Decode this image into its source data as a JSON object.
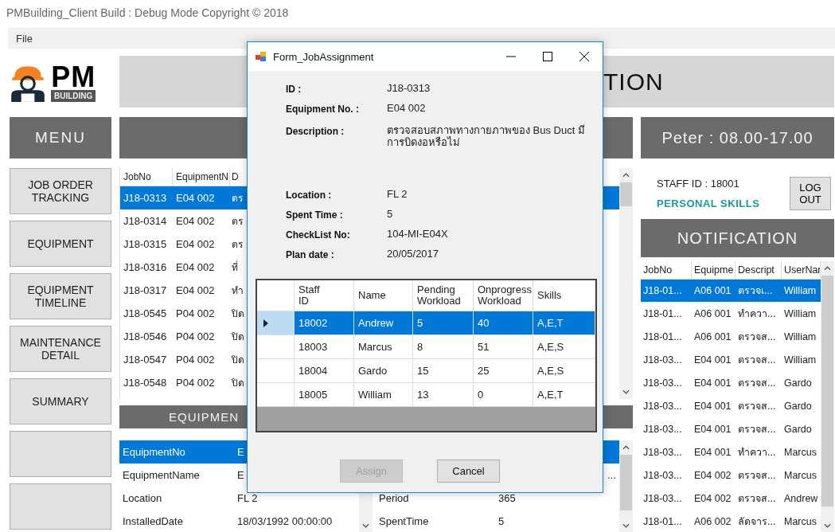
{
  "app_title": "PMBuilding_Client Build : Debug Mode  Copyright ©  2018",
  "menu_bar": [
    {
      "label": "File"
    }
  ],
  "logo": {
    "main": "PM",
    "sub": "BUILDING"
  },
  "header": {
    "title": "TION"
  },
  "menu": {
    "title": "MENU",
    "items": [
      {
        "kind": "button",
        "label": "JOB ORDER TRACKING"
      },
      {
        "kind": "button",
        "label": "EQUIPMENT"
      },
      {
        "kind": "button",
        "label": "EQUIPMENT TIMELINE"
      },
      {
        "kind": "button",
        "label": "MAINTENANCE DETAIL"
      },
      {
        "kind": "button",
        "label": "SUMMARY"
      },
      {
        "kind": "blank"
      },
      {
        "kind": "blank"
      }
    ]
  },
  "jobs": {
    "columns": [
      "JobNo",
      "EquipmentN",
      "D"
    ],
    "rows": [
      {
        "cells": [
          "J18-0313",
          "E04 002",
          "ตร"
        ],
        "selected": true
      },
      {
        "cells": [
          "J18-0314",
          "E04 002",
          "ตร"
        ],
        "selected": false
      },
      {
        "cells": [
          "J18-0315",
          "E04 002",
          "ตร"
        ],
        "selected": false
      },
      {
        "cells": [
          "J18-0316",
          "E04 002",
          "ที่"
        ],
        "selected": false
      },
      {
        "cells": [
          "J18-0317",
          "E04 002",
          "ทำ"
        ],
        "selected": false
      },
      {
        "cells": [
          "J18-0545",
          "P04 002",
          "ปิด"
        ],
        "selected": false
      },
      {
        "cells": [
          "J18-0546",
          "P04 002",
          "ปิด"
        ],
        "selected": false
      },
      {
        "cells": [
          "J18-0547",
          "P04 002",
          "ปิด"
        ],
        "selected": false
      },
      {
        "cells": [
          "J18-0548",
          "P04 002",
          "ปิด"
        ],
        "selected": false
      }
    ]
  },
  "equipment": {
    "title": "EQUIPMEN",
    "left": [
      {
        "name": "EquipmentNo",
        "value": "E",
        "selected": true
      },
      {
        "name": "EquipmentName",
        "value": "E",
        "selected": false
      },
      {
        "name": "Location",
        "value": "FL 2",
        "selected": false
      },
      {
        "name": "InstalledDate",
        "value": "18/03/1992 00:00:00",
        "selected": false
      }
    ],
    "right": [
      {
        "selected": true
      },
      {
        "value": "...",
        "selected": false
      },
      {
        "name": "Period",
        "value": "365",
        "selected": false
      },
      {
        "name": "SpentTime",
        "value": "5",
        "selected": false
      }
    ]
  },
  "user": {
    "title": "Peter : 08.00-17.00",
    "staff_id": "STAFF ID : 18001",
    "skills_link": "PERSONAL SKILLS",
    "logout": "LOG OUT"
  },
  "notification": {
    "title": "NOTIFICATION",
    "columns": [
      "JobNo",
      "Equipme",
      "Descript",
      "UserNar"
    ],
    "rows": [
      {
        "cells": [
          "J18-01...",
          "A06 001",
          "ตรวจเ...",
          "William"
        ],
        "selected": true
      },
      {
        "cells": [
          "J18-01...",
          "A06 001",
          "ทำควา...",
          "William"
        ],
        "selected": false
      },
      {
        "cells": [
          "J18-01...",
          "A06 001",
          "ตรวจส...",
          "William"
        ],
        "selected": false
      },
      {
        "cells": [
          "J18-03...",
          "E04 001",
          "ตรวจส...",
          "William"
        ],
        "selected": false
      },
      {
        "cells": [
          "J18-03...",
          "E04 001",
          "ตรวจส...",
          "Gardo"
        ],
        "selected": false
      },
      {
        "cells": [
          "J18-03...",
          "E04 001",
          "ตรวจส...",
          "Gardo"
        ],
        "selected": false
      },
      {
        "cells": [
          "J18-03...",
          "E04 001",
          "ตรวจส...",
          "Gardo"
        ],
        "selected": false
      },
      {
        "cells": [
          "J18-03...",
          "E04 001",
          "ทำควา...",
          "Marcus"
        ],
        "selected": false
      },
      {
        "cells": [
          "J18-03...",
          "E04 002",
          "ตรวจส...",
          "Marcus"
        ],
        "selected": false
      },
      {
        "cells": [
          "J18-03...",
          "E04 002",
          "ตรวจส...",
          "Andrew"
        ],
        "selected": false
      },
      {
        "cells": [
          "J18-01...",
          "A06 002",
          "ลัดจาร...",
          "Marcus"
        ],
        "selected": false
      }
    ]
  },
  "dialog": {
    "title": "Form_JobAssignment",
    "fields": [
      {
        "kind": "line",
        "label": "ID :",
        "value": "J18-0313"
      },
      {
        "kind": "line",
        "label": "Equipment No. :",
        "value": "E04 002"
      },
      {
        "kind": "multiline",
        "label": "Description :",
        "value": "ตรวจสอบสภาพทางกายภาพของ Bus Duct มีการบิดงอหรือไม่"
      },
      {
        "kind": "line",
        "label": "Location :",
        "value": "FL 2"
      },
      {
        "kind": "line",
        "label": "Spent Time :",
        "value": "5"
      },
      {
        "kind": "line",
        "label": "CheckList No:",
        "value": "104-MI-E04X"
      },
      {
        "kind": "line",
        "label": "Plan date :",
        "value": "20/05/2017"
      }
    ],
    "staff_grid": {
      "columns": [
        "Staff ID",
        "Name",
        "Pending Workload",
        "Onprogress Workload",
        "Skills"
      ],
      "rows": [
        {
          "cells": [
            "18002",
            "Andrew",
            "5",
            "40",
            "A,E,T"
          ],
          "selected": true
        },
        {
          "cells": [
            "18003",
            "Marcus",
            "8",
            "51",
            "A,E,S"
          ],
          "selected": false
        },
        {
          "cells": [
            "18004",
            "Gardo",
            "15",
            "25",
            "A,E,S"
          ],
          "selected": false
        },
        {
          "cells": [
            "18005",
            "William",
            "13",
            "0",
            "A,E,T"
          ],
          "selected": false
        }
      ]
    },
    "buttons": [
      {
        "label": "Assign",
        "disabled": true
      },
      {
        "label": "Cancel",
        "disabled": false
      }
    ]
  }
}
